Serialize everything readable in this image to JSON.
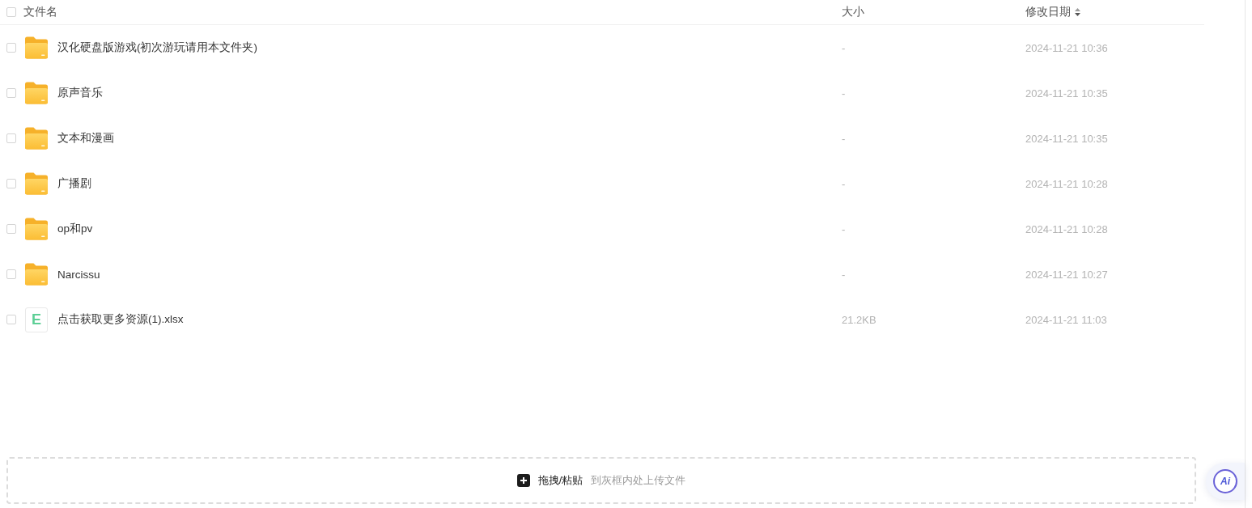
{
  "header": {
    "checked": false,
    "columns": [
      {
        "label": "文件名"
      },
      {
        "label": "大小"
      },
      {
        "label": "修改日期",
        "sortable": true
      }
    ]
  },
  "files": [
    {
      "kind": "folder",
      "name": "汉化硬盘版游戏(初次游玩请用本文件夹)",
      "size": "-",
      "modified": "2024-11-21 10:36",
      "checked": false
    },
    {
      "kind": "folder",
      "name": "原声音乐",
      "size": "-",
      "modified": "2024-11-21 10:35",
      "checked": false
    },
    {
      "kind": "folder",
      "name": "文本和漫画",
      "size": "-",
      "modified": "2024-11-21 10:35",
      "checked": false
    },
    {
      "kind": "folder",
      "name": "广播剧",
      "size": "-",
      "modified": "2024-11-21 10:28",
      "checked": false
    },
    {
      "kind": "folder",
      "name": "op和pv",
      "size": "-",
      "modified": "2024-11-21 10:28",
      "checked": false
    },
    {
      "kind": "folder",
      "name": "Narcissu",
      "size": "-",
      "modified": "2024-11-21 10:27",
      "checked": false
    },
    {
      "kind": "spreadsheet",
      "icon_label": "E",
      "name": "点击获取更多资源(1).xlsx",
      "size": "21.2KB",
      "modified": "2024-11-21 11:03",
      "checked": false
    }
  ],
  "upload_zone": {
    "action": "拖拽/粘贴",
    "hint": "到灰框内处上传文件"
  },
  "ai_button": {
    "label": "Ai"
  }
}
